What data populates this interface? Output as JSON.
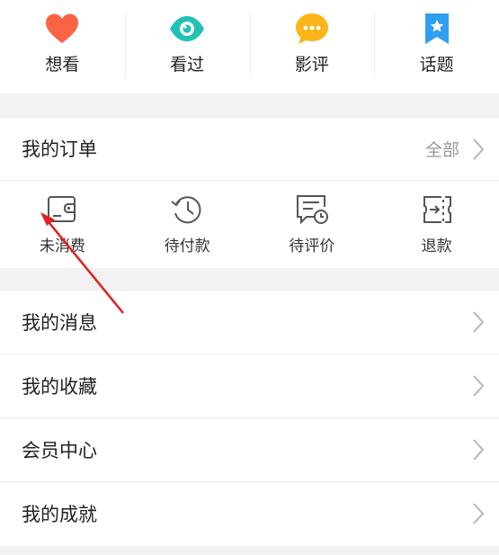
{
  "top_nav": [
    {
      "label": "想看",
      "icon": "heart-icon"
    },
    {
      "label": "看过",
      "icon": "eye-icon"
    },
    {
      "label": "影评",
      "icon": "comment-icon"
    },
    {
      "label": "话题",
      "icon": "bookmark-star-icon"
    }
  ],
  "orders": {
    "title": "我的订单",
    "all_label": "全部",
    "items": [
      {
        "label": "未消费",
        "icon": "wallet-icon"
      },
      {
        "label": "待付款",
        "icon": "history-clock-icon"
      },
      {
        "label": "待评价",
        "icon": "review-clock-icon"
      },
      {
        "label": "退款",
        "icon": "refund-icon"
      }
    ]
  },
  "menu": [
    {
      "label": "我的消息"
    },
    {
      "label": "我的收藏"
    },
    {
      "label": "会员中心"
    },
    {
      "label": "我的成就"
    }
  ],
  "colors": {
    "heart": "#fa6445",
    "eye": "#21c2b5",
    "comment": "#fcb61b",
    "bookmark": "#2f9ff0",
    "outline_icon": "#555555",
    "annotation_arrow": "#e02020"
  }
}
